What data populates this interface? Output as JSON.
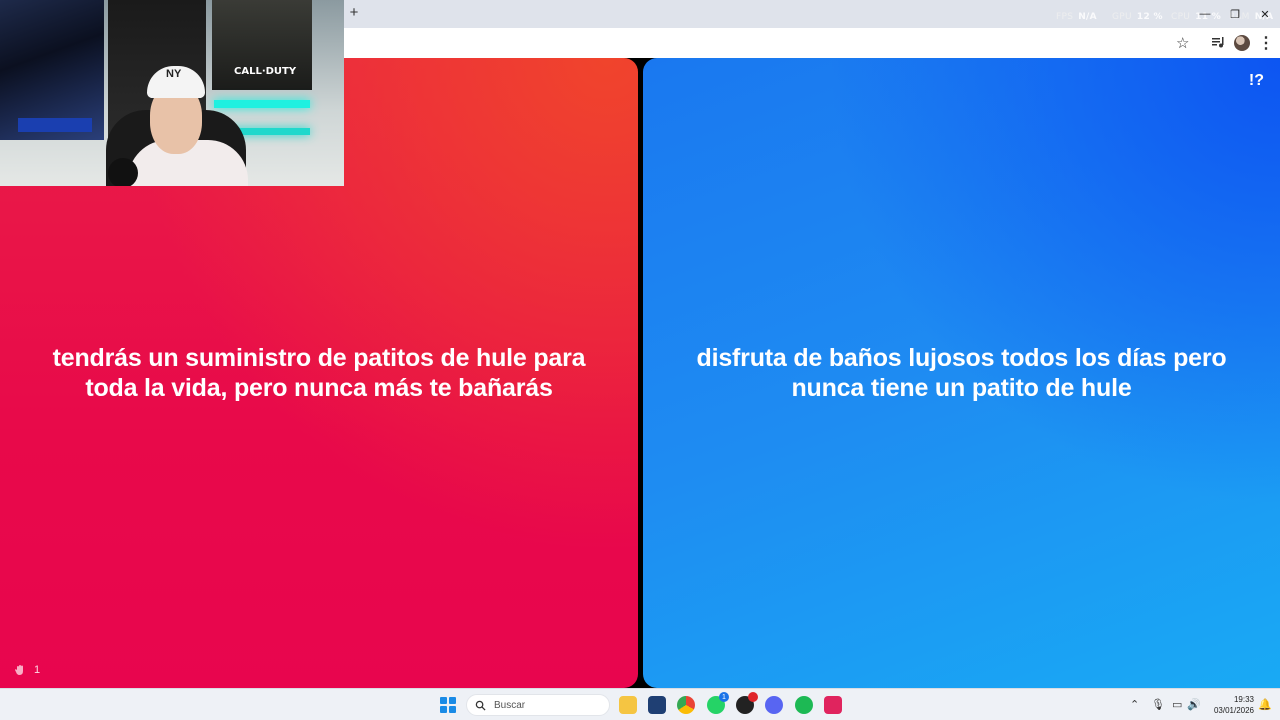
{
  "browser": {
    "new_tab_label": "+",
    "overlay": [
      {
        "key": "FPS",
        "value": "N/A"
      },
      {
        "key": "GPU",
        "value": "12 %"
      },
      {
        "key": "CPU",
        "value": "11 %"
      },
      {
        "key": "RAM",
        "value": "N/A"
      }
    ],
    "window_controls": [
      "—",
      "❐",
      "✕"
    ]
  },
  "game": {
    "option_left": "tendrás un suministro de patitos de hule para toda la vida, pero nunca más te bañarás",
    "option_right": "disfruta de baños lujosos todos los días pero nunca tiene un patito de hule",
    "help_label": "!?",
    "vote_count": "1"
  },
  "webcam": {
    "cap_logo": "NY",
    "poster_title": "CALL·DUTY"
  },
  "taskbar": {
    "search_placeholder": "Buscar",
    "whatsapp_badge": "1",
    "time": "19:33",
    "date": "03/01/2026"
  },
  "colors": {
    "left_card": "#e8094a",
    "right_card": "#1e8cf2",
    "taskbar": "#eef1f6"
  }
}
